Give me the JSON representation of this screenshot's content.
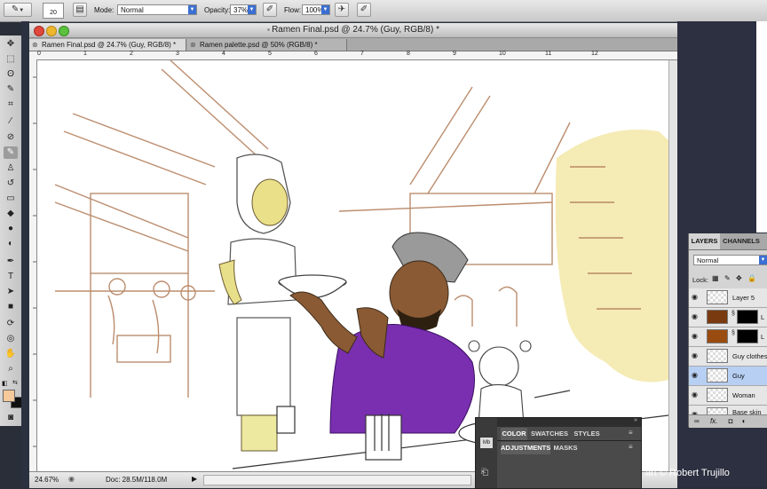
{
  "options_bar": {
    "brush_size": "20",
    "mode_label": "Mode:",
    "mode_value": "Normal",
    "opacity_label": "Opacity:",
    "opacity_value": "37%",
    "flow_label": "Flow:",
    "flow_value": "100%"
  },
  "window": {
    "title": "Ramen Final.psd @ 24.7% (Guy, RGB/8) *"
  },
  "tabs": [
    {
      "label": "Ramen Final.psd @ 24.7% (Guy, RGB/8) *"
    },
    {
      "label": "Ramen palette.psd @ 50% (RGB/8) *"
    }
  ],
  "ruler_top": [
    "0",
    "1",
    "2",
    "3",
    "4",
    "5",
    "6",
    "7",
    "8",
    "9",
    "10",
    "11",
    "12"
  ],
  "status": {
    "zoom": "24.67%",
    "doc_size": "Doc: 28.5M/118.0M"
  },
  "layers_panel": {
    "tabs": [
      "LAYERS",
      "CHANNELS"
    ],
    "blend_mode": "Normal",
    "lock_label": "Lock:",
    "layers": [
      {
        "name": "Layer 5",
        "selected": false
      },
      {
        "name": "L",
        "selected": false
      },
      {
        "name": "L",
        "selected": false
      },
      {
        "name": "Guy clothes",
        "selected": false
      },
      {
        "name": "Guy",
        "selected": true
      },
      {
        "name": "Woman",
        "selected": false
      },
      {
        "name": "Base skin",
        "selected": false
      }
    ]
  },
  "color_panel": {
    "tabs_top": [
      "COLOR",
      "SWATCHES",
      "STYLES"
    ],
    "tabs_bottom": [
      "ADJUSTMENTS",
      "MASKS"
    ]
  },
  "credit": "art © Robert Trujillo",
  "colors": {
    "foreground_swatch": "#f5c99a",
    "background_swatch": "#111111",
    "selection_blue": "#b7cff3",
    "guy_shirt": "#7a2fb0",
    "guy_skin": "#8a5a35",
    "wash_yellow": "#f1e49c"
  }
}
